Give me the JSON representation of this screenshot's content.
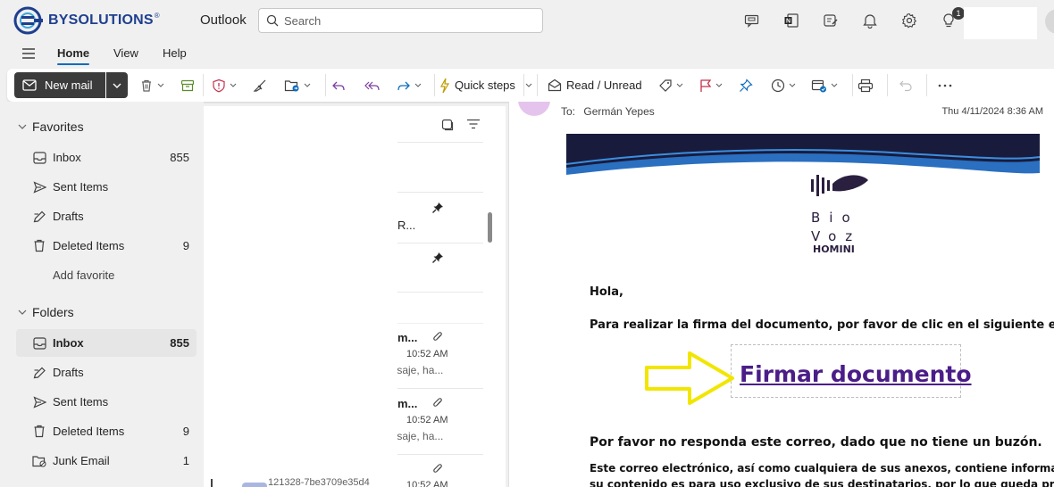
{
  "brand": {
    "name": "BYSOLUTIONS",
    "reg": "®"
  },
  "app": {
    "name": "Outlook"
  },
  "search": {
    "placeholder": "Search"
  },
  "header": {
    "notification_count": "1"
  },
  "tabs": [
    {
      "label": "Home"
    },
    {
      "label": "View"
    },
    {
      "label": "Help"
    }
  ],
  "ribbon": {
    "new_mail": "New mail",
    "quick_steps": "Quick steps",
    "read_unread": "Read / Unread"
  },
  "favorites": {
    "title": "Favorites",
    "items": [
      {
        "label": "Inbox",
        "count": "855"
      },
      {
        "label": "Sent Items",
        "count": ""
      },
      {
        "label": "Drafts",
        "count": ""
      },
      {
        "label": "Deleted Items",
        "count": "9"
      }
    ],
    "add_favorite": "Add favorite"
  },
  "folders": {
    "title": "Folders",
    "items": [
      {
        "label": "Inbox",
        "count": "855"
      },
      {
        "label": "Drafts",
        "count": ""
      },
      {
        "label": "Sent Items",
        "count": ""
      },
      {
        "label": "Deleted Items",
        "count": "9"
      },
      {
        "label": "Junk Email",
        "count": "1"
      }
    ]
  },
  "message_list": {
    "pinned_fragment": "R...",
    "rows": [
      {
        "subject": "m...",
        "time": "10:52 AM",
        "preview": "ısaje, ha..."
      },
      {
        "subject": "m...",
        "time": "10:52 AM",
        "preview": "ısaje, ha..."
      },
      {
        "subject": "",
        "time": "10:52 AM",
        "preview": ""
      }
    ],
    "bottom_fragment": "121328-7be3709e35d4"
  },
  "reading": {
    "to_label": "To:",
    "to_name": "Germán Yepes",
    "date": "Thu 4/11/2024 8:36 AM",
    "logo": {
      "line1": "Bio",
      "line2": "Voz",
      "line3": "HOMINI"
    },
    "greeting": "Hola,",
    "instruction": "Para realizar la firma del documento, por favor de clic en el siguiente enlace:",
    "link_text": "Firmar documento",
    "no_reply": "Por favor no responda este correo, dado que no tiene un buzón.",
    "disclaimer_1": "Este correo electrónico, así como cualquiera de sus anexos, contiene información c",
    "disclaimer_2": "su contenido es para uso exclusivo de sus destinatarios, por lo que queda prohibida"
  },
  "colors": {
    "accent": "#0f6cbd",
    "brand": "#1e3f8f",
    "banner": "#191b3c",
    "link": "#4b1d88",
    "arrow": "#f2e600"
  }
}
